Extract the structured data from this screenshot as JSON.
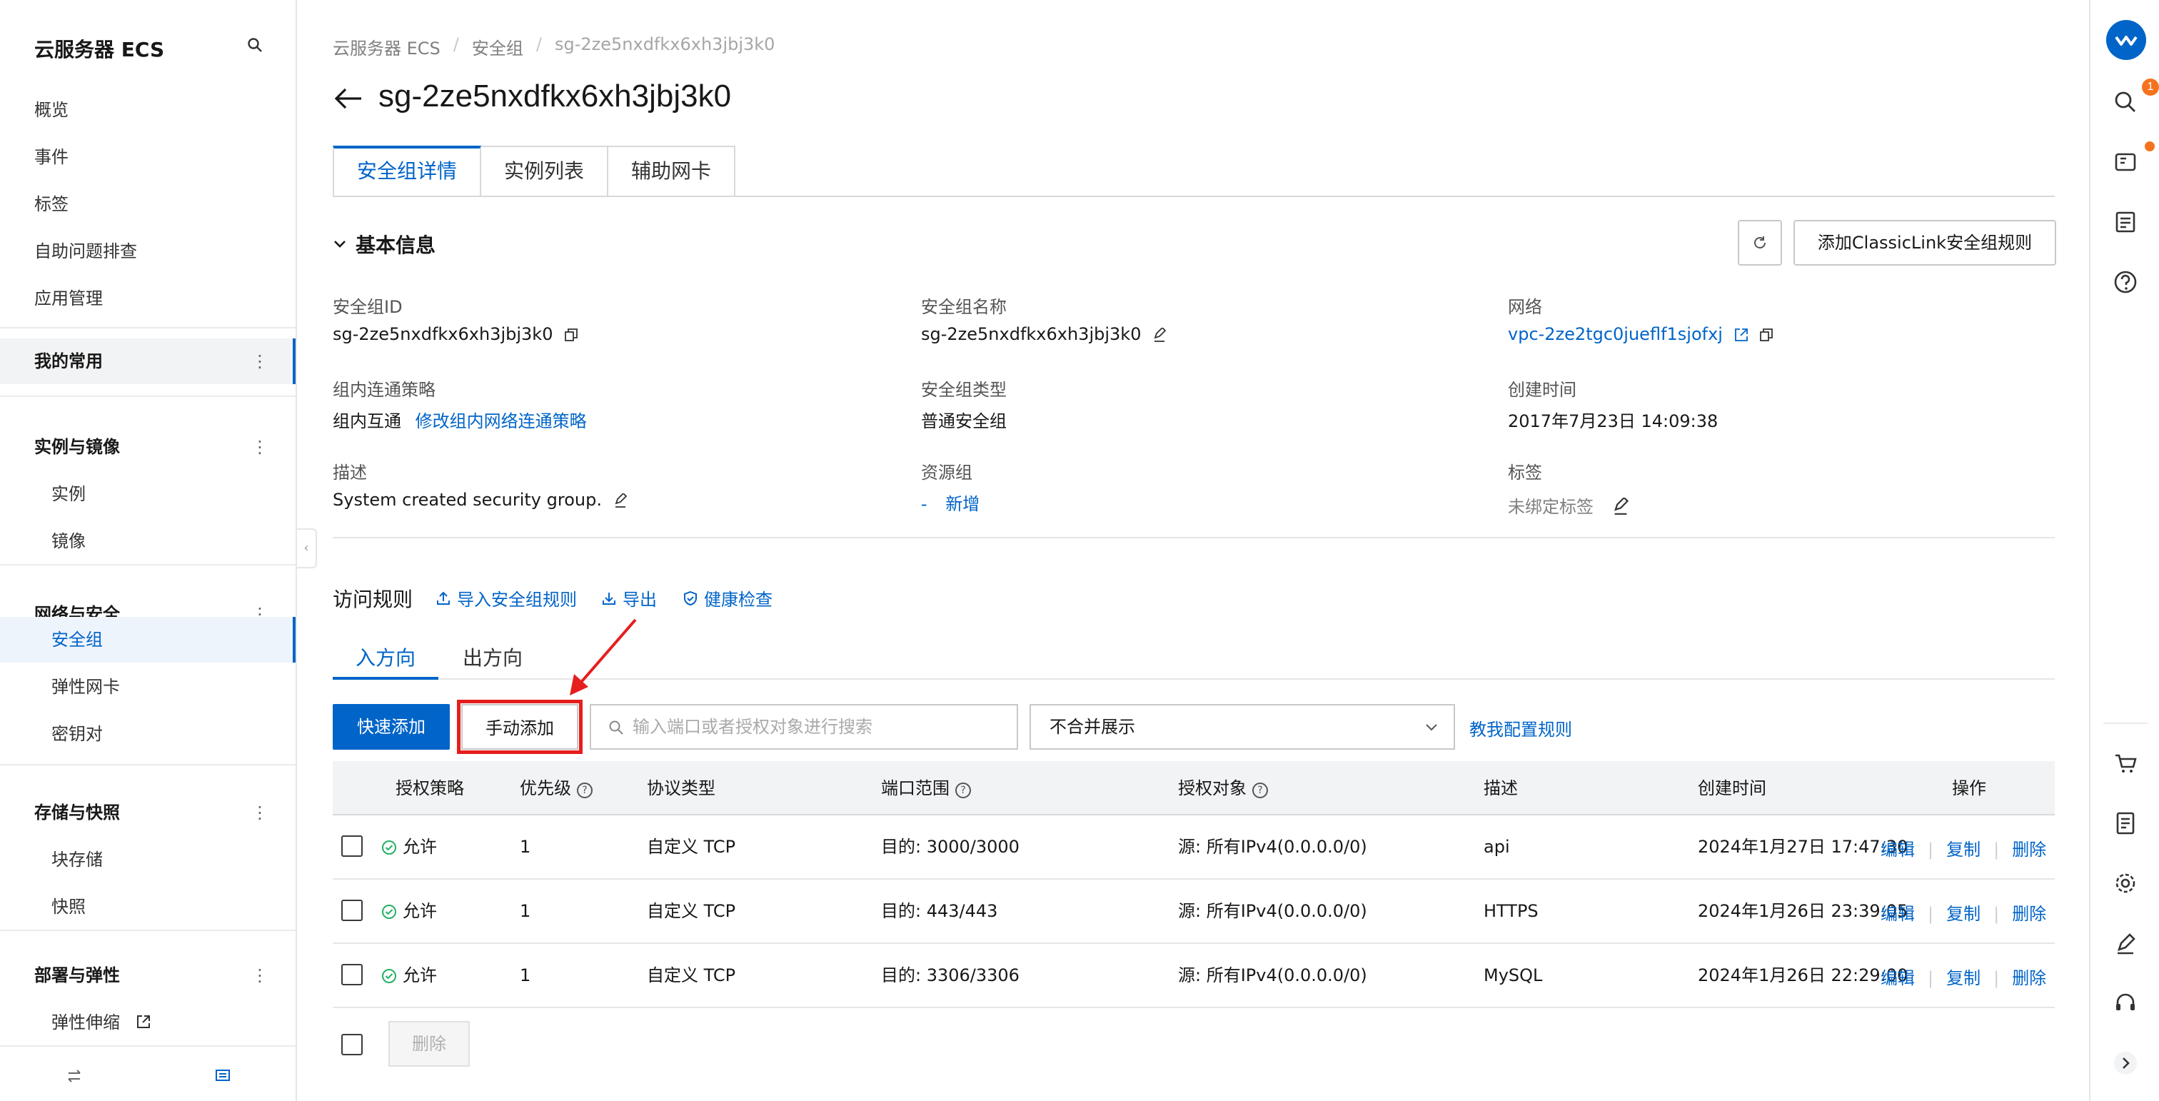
{
  "sidebar": {
    "title": "云服务器 ECS",
    "top_items": [
      "概览",
      "事件",
      "标签",
      "自助问题排查",
      "应用管理"
    ],
    "favorites": "我的常用",
    "groups": [
      {
        "label": "实例与镜像",
        "items": [
          "实例",
          "镜像"
        ]
      },
      {
        "label": "网络与安全",
        "items": [
          "安全组",
          "弹性网卡",
          "密钥对"
        ]
      },
      {
        "label": "存储与快照",
        "items": [
          "块存储",
          "快照"
        ]
      },
      {
        "label": "部署与弹性",
        "items": [
          "弹性伸缩"
        ]
      }
    ],
    "active_item": "安全组"
  },
  "right_rail": {
    "notification_count": "1"
  },
  "breadcrumb": [
    "云服务器 ECS",
    "安全组",
    "sg-2ze5nxdfkx6xh3jbj3k0"
  ],
  "page_title": "sg-2ze5nxdfkx6xh3jbj3k0",
  "tabs": [
    {
      "label": "安全组详情",
      "active": true
    },
    {
      "label": "实例列表",
      "active": false
    },
    {
      "label": "辅助网卡",
      "active": false
    }
  ],
  "basic_info": {
    "section_title": "基本信息",
    "add_classiclink_button": "添加ClassicLink安全组规则",
    "fields": {
      "sg_id_label": "安全组ID",
      "sg_id_value": "sg-2ze5nxdfkx6xh3jbj3k0",
      "sg_name_label": "安全组名称",
      "sg_name_value": "sg-2ze5nxdfkx6xh3jbj3k0",
      "network_label": "网络",
      "network_value": "vpc-2ze2tgc0jueflf1sjofxj",
      "policy_label": "组内连通策略",
      "policy_value": "组内互通",
      "policy_link": "修改组内网络连通策略",
      "sg_type_label": "安全组类型",
      "sg_type_value": "普通安全组",
      "created_label": "创建时间",
      "created_value": "2017年7月23日 14:09:38",
      "desc_label": "描述",
      "desc_value": "System created security group.",
      "rg_label": "资源组",
      "rg_dash": "-",
      "rg_add": "新增",
      "tag_label": "标签",
      "tag_value": "未绑定标签"
    }
  },
  "rules": {
    "title": "访问规则",
    "links": [
      "导入安全组规则",
      "导出",
      "健康检查"
    ],
    "direction_tabs": [
      {
        "label": "入方向",
        "active": true
      },
      {
        "label": "出方向",
        "active": false
      }
    ],
    "quick_add": "快速添加",
    "manual_add": "手动添加",
    "search_placeholder": "输入端口或者授权对象进行搜索",
    "merge_select": "不合并展示",
    "teach_link": "教我配置规则",
    "columns": [
      "授权策略",
      "优先级",
      "协议类型",
      "端口范围",
      "授权对象",
      "描述",
      "创建时间",
      "操作"
    ],
    "rows": [
      {
        "policy": "允许",
        "priority": "1",
        "protocol": "自定义 TCP",
        "port": "目的: 3000/3000",
        "source": "源: 所有IPv4(0.0.0.0/0)",
        "desc": "api",
        "created": "2024年1月27日 17:47:30"
      },
      {
        "policy": "允许",
        "priority": "1",
        "protocol": "自定义 TCP",
        "port": "目的: 443/443",
        "source": "源: 所有IPv4(0.0.0.0/0)",
        "desc": "HTTPS",
        "created": "2024年1月26日 23:39:05"
      },
      {
        "policy": "允许",
        "priority": "1",
        "protocol": "自定义 TCP",
        "port": "目的: 3306/3306",
        "source": "源: 所有IPv4(0.0.0.0/0)",
        "desc": "MySQL",
        "created": "2024年1月26日 22:29:00"
      }
    ],
    "row_actions": [
      "编辑",
      "复制",
      "删除"
    ],
    "bulk_delete": "删除"
  },
  "colors": {
    "accent": "#0064c8",
    "highlight_box": "#e61e1e",
    "allow_green": "#23b066",
    "badge_orange": "#f5731f"
  }
}
